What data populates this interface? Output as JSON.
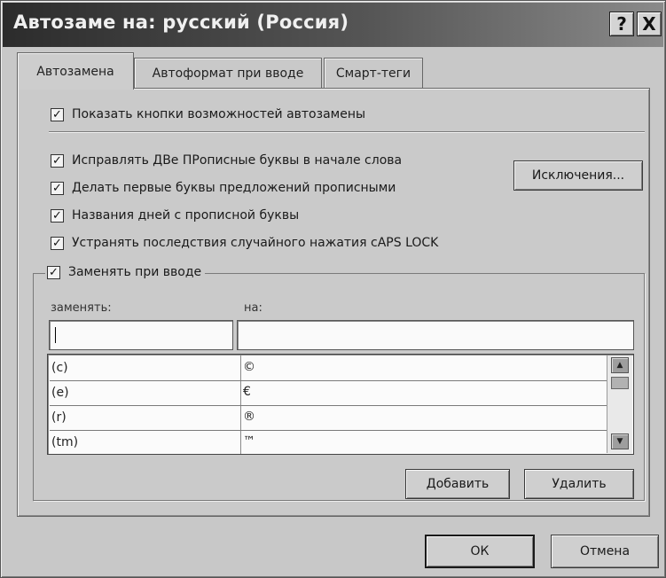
{
  "window": {
    "title": "Автозаме на: русский (Россия)",
    "help_label": "?",
    "close_label": "X"
  },
  "tabs": [
    {
      "label": "Автозамена",
      "active": true
    },
    {
      "label": "Автоформат при вводе",
      "active": false
    },
    {
      "label": "Смарт-теги",
      "active": false
    }
  ],
  "options": {
    "show_buttons": {
      "label": "Показать кнопки возможностей автозамены",
      "checked": true
    },
    "two_caps": {
      "label": "Исправлять ДВе ПРописные буквы в начале слова",
      "checked": true
    },
    "sentence_caps": {
      "label": "Делать первые буквы предложений прописными",
      "checked": true
    },
    "day_names": {
      "label": "Названия дней с прописной буквы",
      "checked": true
    },
    "caps_lock": {
      "label": "Устранять последствия случайного нажатия cAPS LOCK",
      "checked": true
    },
    "replace_as_type": {
      "label": "Заменять при вводе",
      "checked": true
    }
  },
  "exceptions_button": "Исключения...",
  "replace_table": {
    "col_replace": "заменять:",
    "col_with": "на:",
    "replace_value": "",
    "with_value": "",
    "rows": [
      {
        "replace": "(c)",
        "with": "©"
      },
      {
        "replace": "(e)",
        "with": "€"
      },
      {
        "replace": "(r)",
        "with": "®"
      },
      {
        "replace": "(tm)",
        "with": "™"
      }
    ]
  },
  "add_button": "Добавить",
  "delete_button": "Удалить",
  "ok_button": "ОК",
  "cancel_button": "Отмена",
  "check_mark": "✓"
}
